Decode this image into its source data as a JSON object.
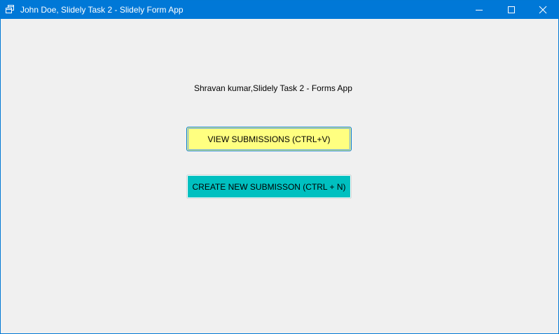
{
  "window": {
    "title": "John Doe, Slidely Task 2 - Slidely Form App",
    "titlebar_color": "#0078d7",
    "background_color": "#f0f0f0",
    "controls": {
      "minimize_icon": "minimize-icon",
      "maximize_icon": "maximize-icon",
      "close_icon": "close-icon"
    }
  },
  "main": {
    "heading": "Shravan kumar,Slidely Task 2 -  Forms App",
    "view_button": {
      "label": "VIEW SUBMISSIONS (CTRL+V)",
      "color": "#ffff80"
    },
    "create_button": {
      "label": "CREATE NEW SUBMISSON (CTRL + N)",
      "color": "#00c0c0"
    }
  }
}
